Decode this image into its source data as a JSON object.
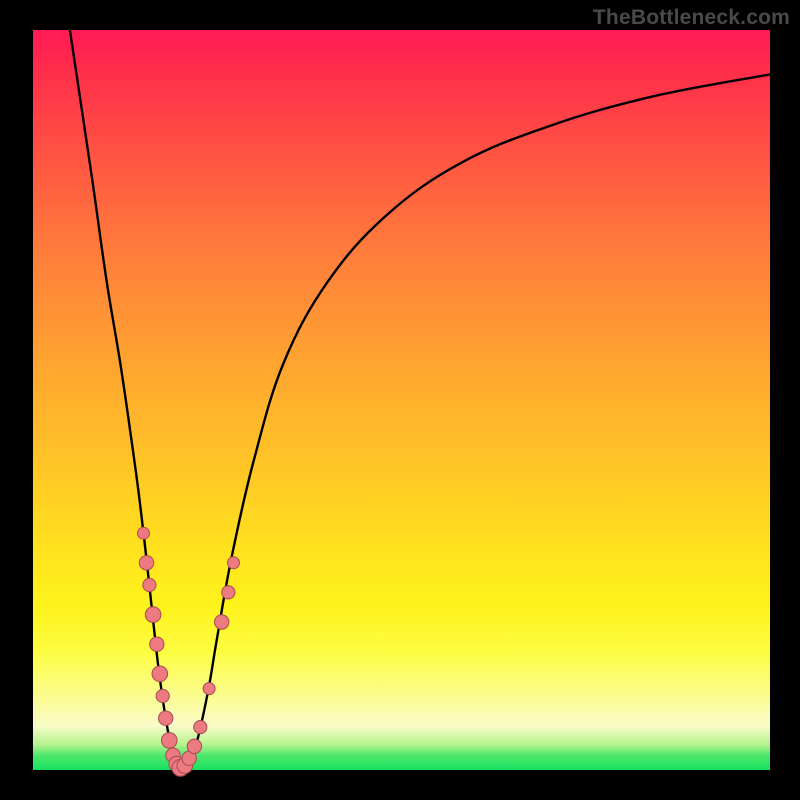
{
  "watermark": "TheBottleneck.com",
  "colors": {
    "frame": "#000000",
    "gradient_top": "#ff1a55",
    "gradient_mid1": "#ffa231",
    "gradient_mid2": "#fef31c",
    "gradient_bottom": "#17e160",
    "curve": "#000000",
    "dot_fill": "#ec7a80",
    "dot_stroke": "#a84b51"
  },
  "chart_data": {
    "type": "line",
    "title": "",
    "xlabel": "",
    "ylabel": "",
    "xlim": [
      0,
      100
    ],
    "ylim": [
      0,
      100
    ],
    "series": [
      {
        "name": "bottleneck-curve",
        "x": [
          5,
          8,
          10,
          12,
          14,
          15,
          16,
          17,
          18,
          19,
          20,
          21,
          22,
          23,
          24,
          25,
          27,
          30,
          34,
          40,
          48,
          58,
          70,
          84,
          100
        ],
        "y": [
          100,
          80,
          66,
          54,
          40,
          32,
          23,
          14,
          7,
          2,
          0,
          1,
          3,
          7,
          12,
          18,
          29,
          42,
          55,
          66,
          75,
          82,
          87,
          91,
          94
        ]
      }
    ],
    "markers": [
      {
        "x": 15.0,
        "y": 32,
        "r": 1.0
      },
      {
        "x": 15.4,
        "y": 28,
        "r": 1.2
      },
      {
        "x": 15.8,
        "y": 25,
        "r": 1.1
      },
      {
        "x": 16.3,
        "y": 21,
        "r": 1.3
      },
      {
        "x": 16.8,
        "y": 17,
        "r": 1.2
      },
      {
        "x": 17.2,
        "y": 13,
        "r": 1.3
      },
      {
        "x": 17.6,
        "y": 10,
        "r": 1.1
      },
      {
        "x": 18.0,
        "y": 7,
        "r": 1.2
      },
      {
        "x": 18.5,
        "y": 4,
        "r": 1.3
      },
      {
        "x": 19.0,
        "y": 2,
        "r": 1.2
      },
      {
        "x": 19.5,
        "y": 0.8,
        "r": 1.3
      },
      {
        "x": 20.0,
        "y": 0.3,
        "r": 1.4
      },
      {
        "x": 20.6,
        "y": 0.6,
        "r": 1.3
      },
      {
        "x": 21.2,
        "y": 1.6,
        "r": 1.2
      },
      {
        "x": 21.9,
        "y": 3.2,
        "r": 1.2
      },
      {
        "x": 22.7,
        "y": 5.8,
        "r": 1.1
      },
      {
        "x": 23.9,
        "y": 11,
        "r": 1.0
      },
      {
        "x": 25.6,
        "y": 20,
        "r": 1.2
      },
      {
        "x": 26.5,
        "y": 24,
        "r": 1.1
      },
      {
        "x": 27.2,
        "y": 28,
        "r": 1.0
      }
    ]
  }
}
